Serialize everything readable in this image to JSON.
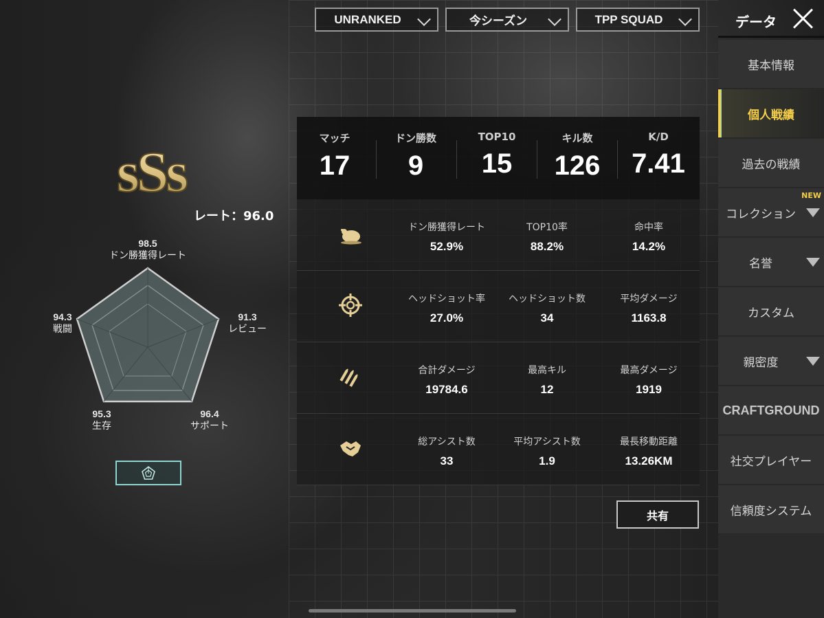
{
  "filters": {
    "mode": "UNRANKED",
    "season": "今シーズン",
    "perspective": "TPP SQUAD"
  },
  "header": {
    "title": "データ"
  },
  "sidebar": {
    "items": [
      {
        "label": "基本情報"
      },
      {
        "label": "個人戦績"
      },
      {
        "label": "過去の戦績"
      },
      {
        "label": "コレクション",
        "badge": "NEW"
      },
      {
        "label": "名誉"
      },
      {
        "label": "カスタム"
      },
      {
        "label": "親密度"
      },
      {
        "label": "CRAFTGROUND"
      },
      {
        "label": "社交プレイヤー"
      },
      {
        "label": "信頼度システム"
      }
    ]
  },
  "rank": {
    "tier": "sSs",
    "rate": "レート：96.0"
  },
  "radar": {
    "axes": [
      {
        "label": "ドン勝獲得レート",
        "value": "98.5"
      },
      {
        "label": "レビュー",
        "value": "91.3"
      },
      {
        "label": "サポート",
        "value": "96.4"
      },
      {
        "label": "生存",
        "value": "95.3"
      },
      {
        "label": "戦闘",
        "value": "94.3"
      }
    ]
  },
  "summary": [
    {
      "label": "マッチ",
      "value": "17"
    },
    {
      "label": "ドン勝数",
      "value": "9"
    },
    {
      "label": "TOP10",
      "value": "15"
    },
    {
      "label": "キル数",
      "value": "126"
    },
    {
      "label": "K/D",
      "value": "7.41"
    }
  ],
  "stats": [
    {
      "icon": "chicken-icon",
      "cells": [
        {
          "label": "ドン勝獲得レート",
          "value": "52.9%"
        },
        {
          "label": "TOP10率",
          "value": "88.2%"
        },
        {
          "label": "命中率",
          "value": "14.2%"
        }
      ]
    },
    {
      "icon": "crosshair-icon",
      "cells": [
        {
          "label": "ヘッドショット率",
          "value": "27.0%"
        },
        {
          "label": "ヘッドショット数",
          "value": "34"
        },
        {
          "label": "平均ダメージ",
          "value": "1163.8"
        }
      ]
    },
    {
      "icon": "bullets-icon",
      "cells": [
        {
          "label": "合計ダメージ",
          "value": "19784.6"
        },
        {
          "label": "最高キル",
          "value": "12"
        },
        {
          "label": "最高ダメージ",
          "value": "1919"
        }
      ]
    },
    {
      "icon": "handshake-icon",
      "cells": [
        {
          "label": "総アシスト数",
          "value": "33"
        },
        {
          "label": "平均アシスト数",
          "value": "1.9"
        },
        {
          "label": "最長移動距離",
          "value": "13.26KM"
        }
      ]
    }
  ],
  "share_label": "共有",
  "colors": {
    "accent": "#f5cf49",
    "teal": "#8fd6cf",
    "gold": "#e6cf96"
  }
}
